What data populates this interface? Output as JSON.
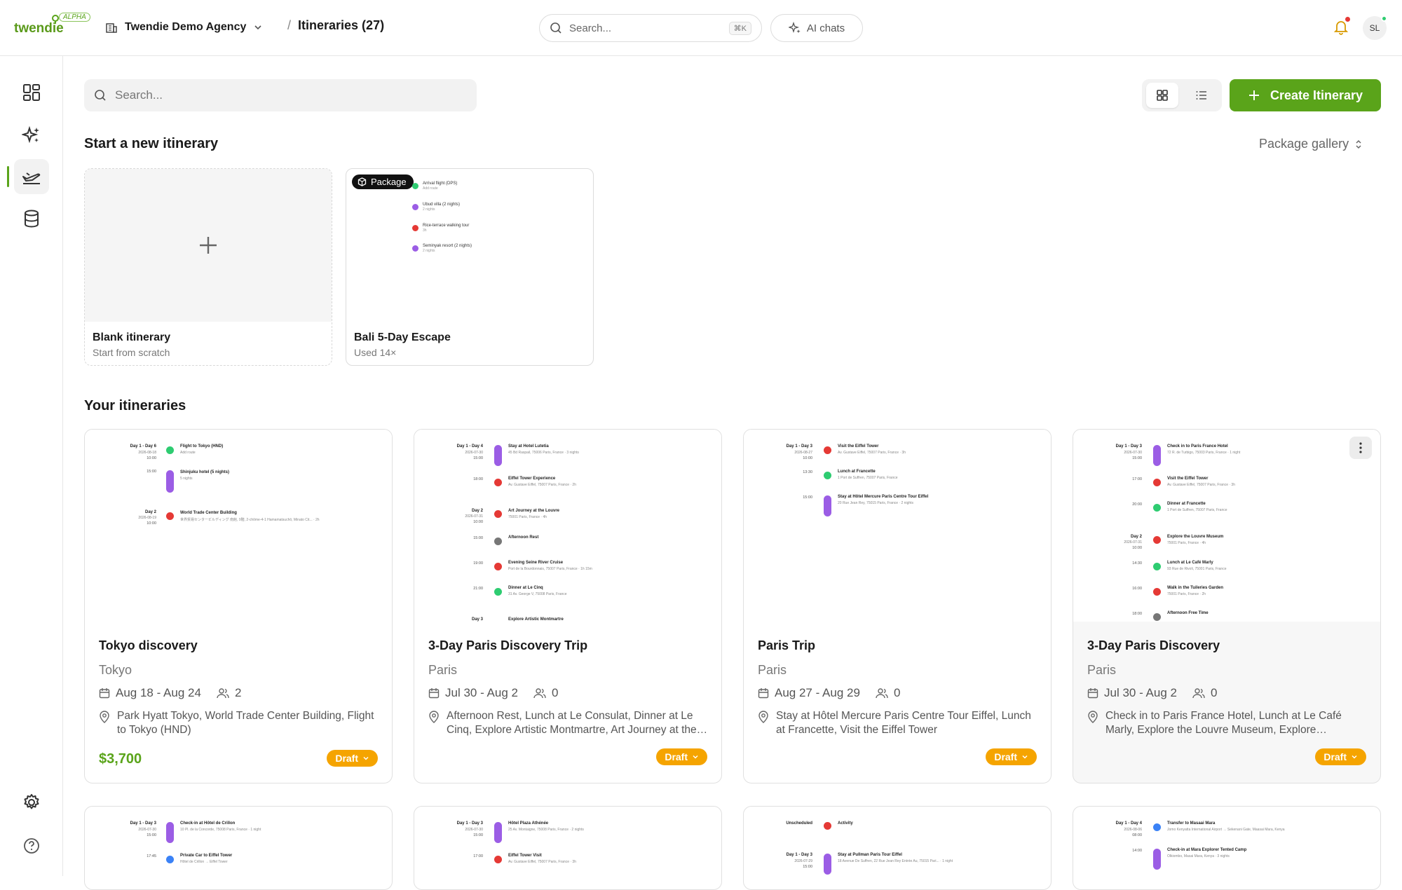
{
  "app": {
    "logo": "twendie",
    "badge": "ALPHA",
    "agency": "Twendie Demo Agency",
    "breadcrumb": "Itineraries (27)",
    "search_placeholder": "Search...",
    "search_shortcut": "⌘K",
    "ai_chats": "AI chats",
    "avatar_initials": "SL"
  },
  "page": {
    "search_placeholder": "Search...",
    "create_label": "Create Itinerary",
    "start_heading": "Start a new itinerary",
    "gallery_label": "Package gallery",
    "yours_heading": "Your itineraries"
  },
  "templates": [
    {
      "title": "Blank itinerary",
      "subtitle": "Start from scratch"
    },
    {
      "title": "Bali 5-Day Escape",
      "subtitle": "Used 14×",
      "badge": "Package",
      "items": [
        {
          "t": "Arrival flight (DPS)",
          "s": "Add route"
        },
        {
          "t": "Ubud villa (2 nights)",
          "s": "2 nights"
        },
        {
          "t": "Rice-terrace walking tour",
          "s": "3h"
        },
        {
          "t": "Seminyak resort (2 nights)",
          "s": "2 nights"
        }
      ]
    }
  ],
  "itineraries": [
    {
      "title": "Tokyo discovery",
      "city": "Tokyo",
      "dates": "Aug 18 - Aug 24",
      "travelers": "2",
      "summary": "Park Hyatt Tokyo, World Trade Center Building, Flight to Tokyo (HND)",
      "price": "$3,700",
      "status": "Draft",
      "preview": {
        "d1": "Day 1 - Day 6",
        "d1date": "2026-08-18",
        "t1": "10:00",
        "e1": "Flight to Tokyo (HND)",
        "s1": "Add route",
        "t2": "15:00",
        "e2": "Shinjuku hotel (5 nights)",
        "s2": "5 nights",
        "d2": "Day 2",
        "d2date": "2026-08-19",
        "t3": "10:00",
        "e3": "World Trade Center Building",
        "s3": "世界貿易センタービルディング 南館, 9階, 2-chōme-4-1 Hamamatsuchō, Minato Cit... · 2h"
      }
    },
    {
      "title": "3-Day Paris Discovery Trip",
      "city": "Paris",
      "dates": "Jul 30 - Aug 2",
      "travelers": "0",
      "summary": "Afternoon Rest, Lunch at Le Consulat, Dinner at Le Cinq, Explore Artistic Montmartre, Art Journey at the Louvre",
      "status": "Draft",
      "preview": {
        "d1": "Day 1 - Day 4",
        "d1date": "2026-07-30",
        "t1": "15:00",
        "e1": "Stay at Hotel Lutetia",
        "s1": "45 Bd Raspail, 75006 Paris, France · 3 nights",
        "t2": "18:00",
        "e2": "Eiffel Tower Experience",
        "s2": "Av. Gustave Eiffel, 75007 Paris, France · 2h",
        "d2": "Day 2",
        "d2date": "2026-07-31",
        "t3": "10:00",
        "e3": "Art Journey at the Louvre",
        "s3": "75001 Paris, France · 4h",
        "t4": "15:00",
        "e4": "Afternoon Rest",
        "t5": "19:00",
        "e5": "Evening Seine River Cruise",
        "s5": "Port de la Bourdonnais, 75007 Paris, France · 1h 15m",
        "t6": "21:00",
        "e6": "Dinner at Le Cinq",
        "s6": "31 Av. George V, 75008 Paris, France",
        "d3": "Day 3",
        "e7": "Explore Artistic Montmartre"
      }
    },
    {
      "title": "Paris Trip",
      "city": "Paris",
      "dates": "Aug 27 - Aug 29",
      "travelers": "0",
      "summary": "Stay at Hôtel Mercure Paris Centre Tour Eiffel, Lunch at Francette, Visit the Eiffel Tower",
      "status": "Draft",
      "preview": {
        "d1": "Day 1 - Day 3",
        "d1date": "2026-08-27",
        "t1": "10:00",
        "e1": "Visit the Eiffel Tower",
        "s1": "Av. Gustave Eiffel, 75007 Paris, France · 3h",
        "t2": "13:30",
        "e2": "Lunch at Francette",
        "s2": "1 Port de Suffren, 75007 Paris, France",
        "t3": "15:00",
        "e3": "Stay at Hôtel Mercure Paris Centre Tour Eiffel",
        "s3": "20 Rue Jean Rey, 75015 Paris, France · 2 nights"
      }
    },
    {
      "title": "3-Day Paris Discovery",
      "city": "Paris",
      "dates": "Jul 30 - Aug 2",
      "travelers": "0",
      "summary": "Check in to Paris France Hotel, Lunch at Le Café Marly, Explore the Louvre Museum, Explore Montmartre",
      "status": "Draft",
      "preview": {
        "d1": "Day 1 - Day 3",
        "d1date": "2026-07-30",
        "t1": "15:00",
        "e1": "Check in to Paris France Hotel",
        "s1": "72 R. de Turbigo, 75003 Paris, France · 1 night",
        "t2": "17:00",
        "e2": "Visit the Eiffel Tower",
        "s2": "Av. Gustave Eiffel, 75007 Paris, France · 3h",
        "t3": "20:00",
        "e3": "Dinner at Francette",
        "s3": "1 Port de Suffren, 75007 Paris, France",
        "d2": "Day 2",
        "d2date": "2026-07-31",
        "t4": "10:00",
        "e4": "Explore the Louvre Museum",
        "s4": "75001 Paris, France · 4h",
        "t5": "14:30",
        "e5": "Lunch at Le Café Marly",
        "s5": "93 Rue de Rivoli, 75001 Paris, France",
        "t6": "16:00",
        "e6": "Walk in the Tuileries Garden",
        "s6": "75001 Paris, France · 2h",
        "t7": "18:00",
        "e7": "Afternoon Free Time"
      }
    }
  ],
  "row2": [
    {
      "d1": "Day 1 - Day 3",
      "d1date": "2026-07-30",
      "t1": "15:00",
      "e1": "Check-in at Hôtel de Crillon",
      "s1": "10 Pl. de la Concorde, 75008 Paris, France · 1 night",
      "t2": "17:45",
      "e2": "Private Car to Eiffel Tower",
      "s2": "Hôtel de Crillon → Eiffel Tower"
    },
    {
      "d1": "Day 1 - Day 3",
      "d1date": "2026-07-30",
      "t1": "15:00",
      "e1": "Hôtel Plaza Athénée",
      "s1": "25 Av. Montaigne, 75008 Paris, France · 2 nights",
      "t2": "17:00",
      "e2": "Eiffel Tower Visit",
      "s2": "Av. Gustave Eiffel, 75007 Paris, France · 3h"
    },
    {
      "d0": "Unscheduled",
      "e0": "Activity",
      "d1": "Day 1 - Day 3",
      "d1date": "2026-07-29",
      "t1": "15:00",
      "e1": "Stay at Pullman Paris Tour Eiffel",
      "s1": "18 Avenue De Suffren, 22 Rue Jean Rey Entrée Au, 75015 Pari... · 1 night"
    },
    {
      "d1": "Day 1 - Day 4",
      "d1date": "2026-08-06",
      "t1": "08:00",
      "e1": "Transfer to Masaai Mara",
      "s1": "Jomo Kenyatta International Airport → Sekenani Gate, Maasai Mara, Kenya",
      "t2": "14:00",
      "e2": "Check-in at Mara Explorer Tented Camp",
      "s2": "Olkiombo, Masai Mara, Kenya · 3 nights"
    }
  ],
  "colors": {
    "accent": "#5aa41a",
    "draft": "#f5a400"
  }
}
